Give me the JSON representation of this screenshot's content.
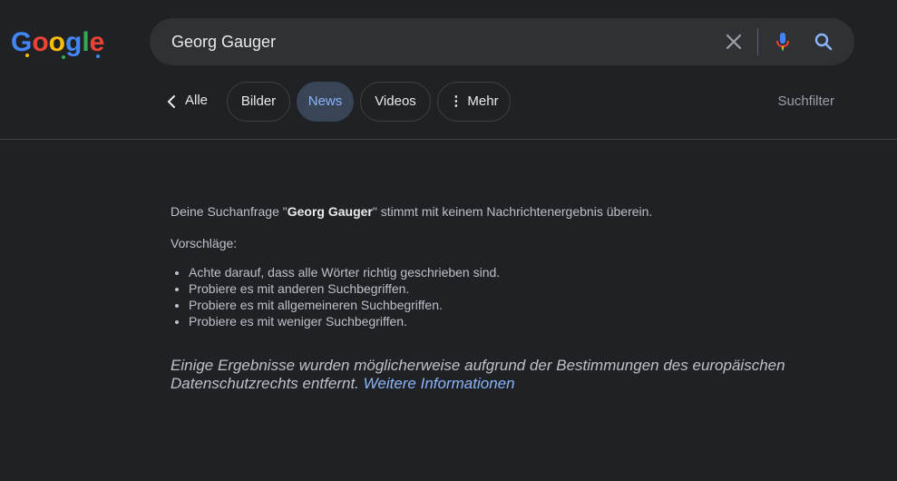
{
  "search": {
    "query": "Georg Gauger"
  },
  "tabs": {
    "back_label": "Alle",
    "items": [
      {
        "label": "Bilder"
      },
      {
        "label": "News"
      },
      {
        "label": "Videos"
      },
      {
        "label": "Mehr"
      }
    ],
    "active": "News",
    "filter_label": "Suchfilter"
  },
  "results": {
    "msg_prefix": "Deine Suchanfrage \"",
    "msg_query": "Georg Gauger",
    "msg_suffix": "\" stimmt mit keinem Nachrichtenergebnis überein.",
    "suggestions_title": "Vorschläge:",
    "suggestions": [
      "Achte darauf, dass alle Wörter richtig geschrieben sind.",
      "Probiere es mit anderen Suchbegriffen.",
      "Probiere es mit allgemeineren Suchbegriffen.",
      "Probiere es mit weniger Suchbegriffen."
    ],
    "privacy_note": "Einige Ergebnisse wurden möglicherweise aufgrund der Bestimmungen des europäischen Datenschutzrechts entfernt.",
    "privacy_link": "Weitere Informationen"
  },
  "icons": {
    "logo": "google-doodle-logo",
    "clear": "close-icon",
    "mic": "microphone-icon",
    "search": "search-icon",
    "back": "chevron-left-icon",
    "more": "vertical-dots-icon"
  },
  "colors": {
    "background": "#202124",
    "searchbar": "#303134",
    "active_tab": "#394457",
    "link": "#8ab4f8"
  }
}
